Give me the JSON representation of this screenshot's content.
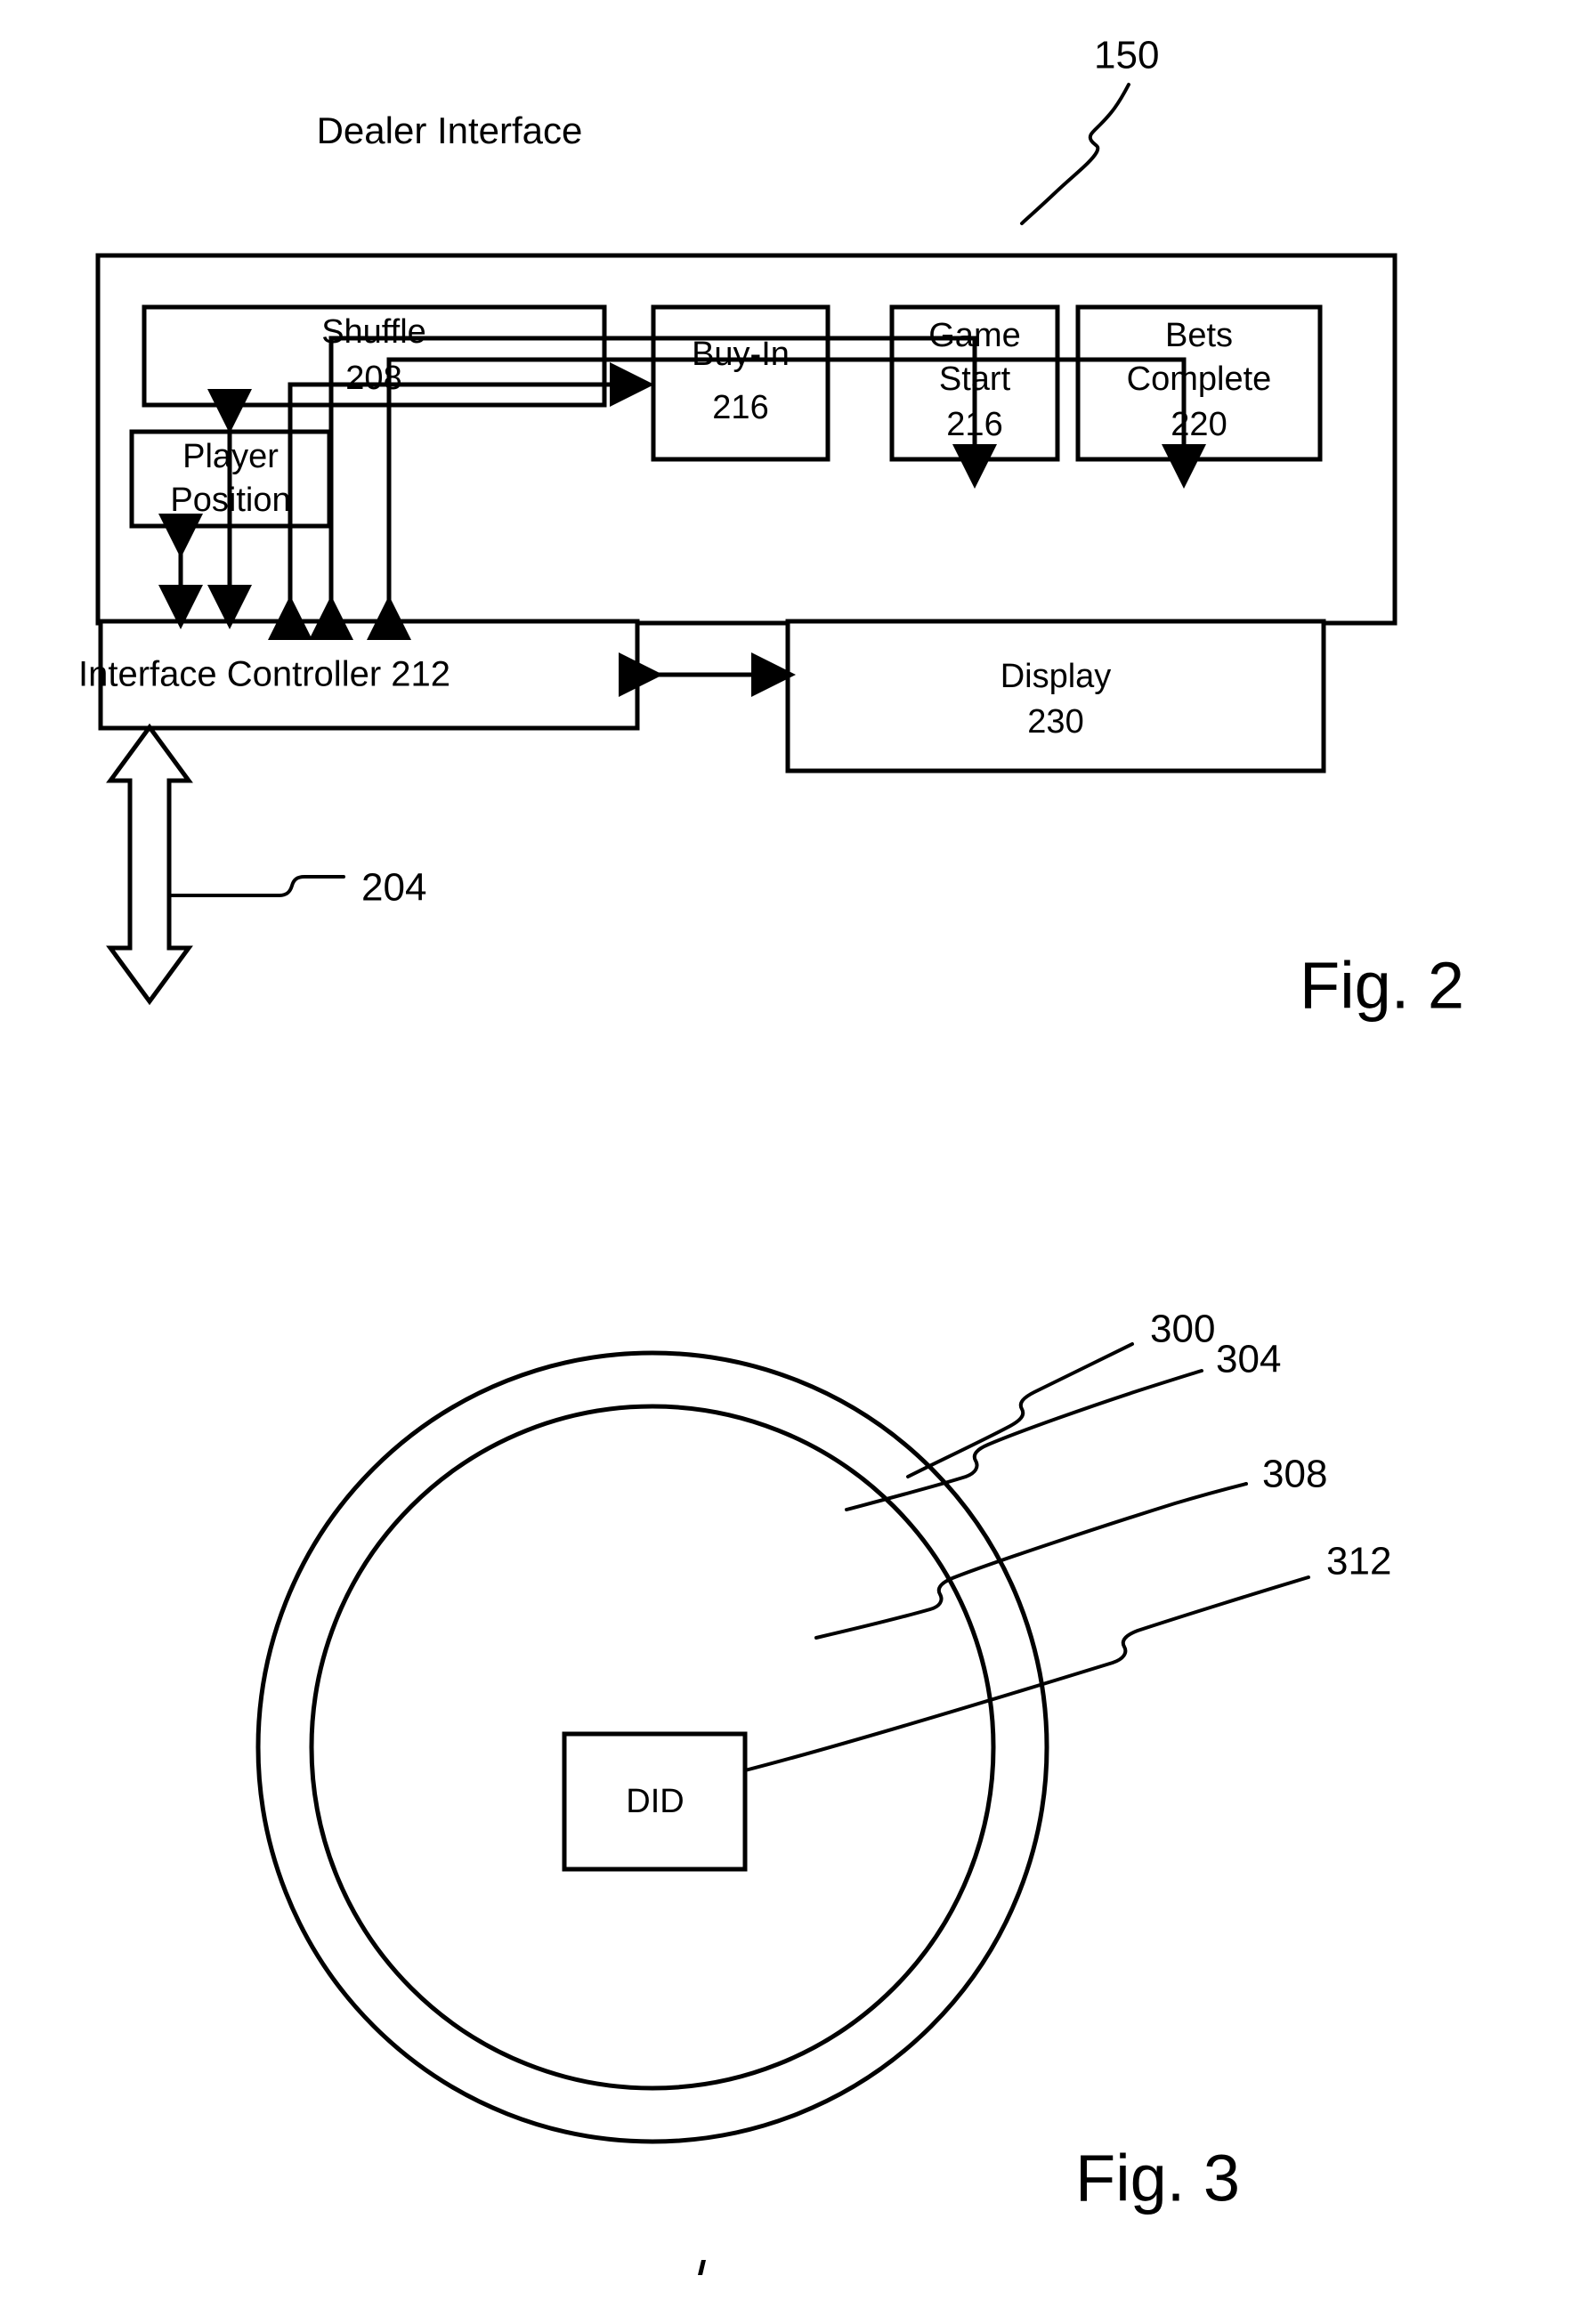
{
  "document": {
    "type": "patent-figure-sheet",
    "figures": [
      {
        "caption": "Fig. 2",
        "title": "Dealer Interface",
        "reference_numeral": "150",
        "interface_reference": "204",
        "boxes": [
          {
            "id": "shuffle",
            "label": "Shuffle",
            "number": "208"
          },
          {
            "id": "player-pos",
            "label": "Player\nPosition",
            "number": ""
          },
          {
            "id": "buy-in",
            "label": "Buy-In",
            "number": "216"
          },
          {
            "id": "game-start",
            "label": "Game\nStart",
            "number": "216"
          },
          {
            "id": "bets-done",
            "label": "Bets\nComplete",
            "number": "220"
          },
          {
            "id": "controller",
            "label": "Interface Controller",
            "number": "212"
          },
          {
            "id": "display",
            "label": "Display",
            "number": "230"
          }
        ],
        "labels": {
          "shuffle_line1": "Shuffle",
          "shuffle_line2": "208",
          "player_line1": "Player",
          "player_line2": "Position",
          "buyin_line1": "Buy-In",
          "buyin_line2": "216",
          "gamestart_line1": "Game",
          "gamestart_line2": "Start",
          "gamestart_line3": "216",
          "bets_line1": "Bets",
          "bets_line2": "Complete",
          "bets_line3": "220",
          "controller_text": "Interface Controller  212",
          "display_line1": "Display",
          "display_line2": "230"
        }
      },
      {
        "caption": "Fig. 3",
        "center_label": "DID",
        "reference_numerals": [
          "300",
          "304",
          "308",
          "312"
        ],
        "labels": {
          "ref_300": "300",
          "ref_304": "304",
          "ref_308": "308",
          "ref_312": "312",
          "did": "DID"
        }
      }
    ]
  },
  "colors": {
    "ink": "#000000",
    "paper": "#ffffff"
  }
}
